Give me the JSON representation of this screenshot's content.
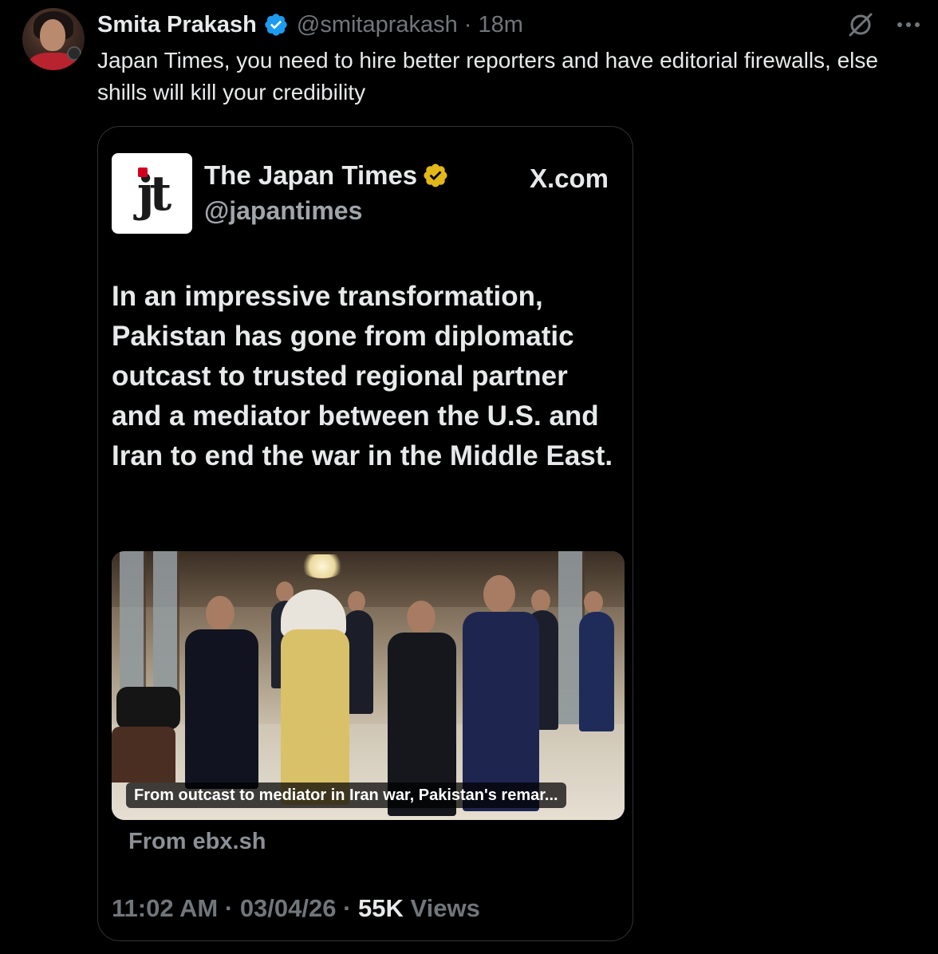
{
  "tweet": {
    "author_name": "Smita Prakash",
    "author_handle": "@smitaprakash",
    "separator": "·",
    "time_ago": "18m",
    "text": "Japan Times, you need to hire better reporters and have editorial firewalls, else shills will kill your credibility"
  },
  "quote": {
    "logo_text": "jt",
    "name": "The Japan Times",
    "handle": "@japantimes",
    "site": "X.com",
    "body": "In an impressive transformation, Pakistan has gone from diplomatic outcast to trusted regional partner and a mediator between the U.S. and Iran to end the war in the Middle East.",
    "card_caption": "From outcast to mediator in Iran war, Pakistan's remar...",
    "card_source": "From ebx.sh",
    "time": "11:02 AM",
    "date": "03/04/26",
    "views_count": "55K",
    "views_label": "Views"
  },
  "icons": {
    "verified_blue": "verified-badge-icon",
    "verified_gold": "gold-verified-badge-icon",
    "grok": "grok-icon",
    "more": "more-icon"
  },
  "colors": {
    "background": "#000000",
    "text": "#e7e9ea",
    "muted": "#71767b",
    "verified_blue": "#1d9bf0",
    "verified_gold": "#e2b719",
    "jt_red": "#d2001f"
  }
}
